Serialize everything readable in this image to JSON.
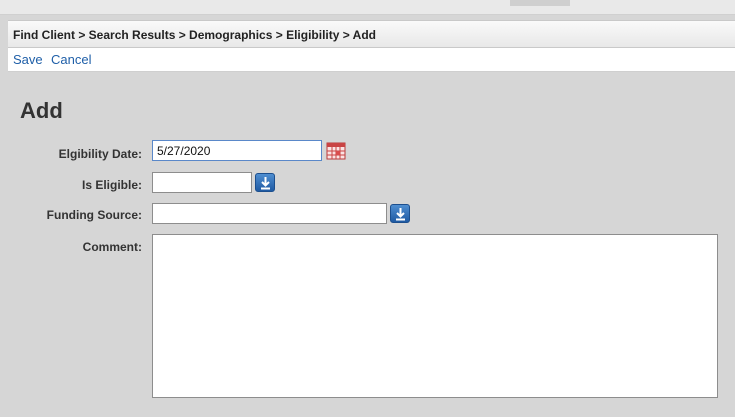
{
  "breadcrumb": "Find Client > Search Results > Demographics > Eligibility > Add",
  "actions": {
    "save": "Save",
    "cancel": "Cancel"
  },
  "page_title": "Add",
  "form": {
    "eligibility_date": {
      "label": "Elgibility Date:",
      "value": "5/27/2020"
    },
    "is_eligible": {
      "label": "Is Eligible:",
      "value": ""
    },
    "funding_source": {
      "label": "Funding Source:",
      "value": ""
    },
    "comment": {
      "label": "Comment:",
      "value": ""
    }
  },
  "icons": {
    "calendar": "calendar-icon",
    "dropdown": "download-arrow-icon"
  },
  "colors": {
    "link": "#1f5fa8",
    "dropdown_button": "#2c6cb5",
    "calendar": "#c0392b",
    "background": "#d6d6d6"
  }
}
